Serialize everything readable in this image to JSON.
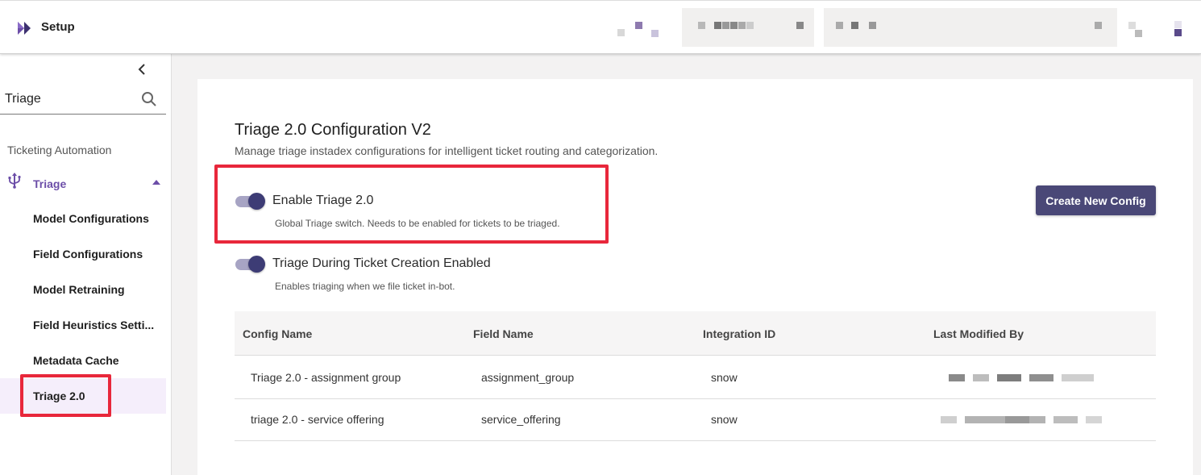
{
  "header": {
    "app_title": "Setup",
    "logo_icon": "double-chevron-logo-icon",
    "accent_color": "#6c4ea8"
  },
  "sidebar": {
    "collapse_icon": "chevron-left-icon",
    "search": {
      "value": "Triage",
      "icon": "search-icon"
    },
    "section_label": "Ticketing Automation",
    "parent": {
      "label": "Triage",
      "icon": "usb-icon",
      "expanded": true
    },
    "items": [
      {
        "label": "Model Configurations"
      },
      {
        "label": "Field Configurations"
      },
      {
        "label": "Model Retraining"
      },
      {
        "label": "Field Heuristics Setti..."
      },
      {
        "label": "Metadata Cache"
      },
      {
        "label": "Triage 2.0",
        "active": true
      }
    ]
  },
  "main": {
    "title": "Triage 2.0 Configuration V2",
    "subtitle": "Manage triage instadex configurations for intelligent ticket routing and categorization.",
    "toggles": [
      {
        "title": "Enable Triage 2.0",
        "description": "Global Triage switch. Needs to be enabled for tickets to be triaged.",
        "enabled": true
      },
      {
        "title": "Triage During Ticket Creation Enabled",
        "description": "Enables triaging when we file ticket in-bot.",
        "enabled": true
      }
    ],
    "create_button": "Create New Config",
    "button_color": "#4a4877",
    "table": {
      "columns": [
        "Config Name",
        "Field Name",
        "Integration ID",
        "Last Modified By"
      ],
      "rows": [
        {
          "config_name": "Triage 2.0 - assignment group",
          "field_name": "assignment_group",
          "integration_id": "snow"
        },
        {
          "config_name": "triage 2.0 - service offering",
          "field_name": "service_offering",
          "integration_id": "snow"
        }
      ]
    }
  },
  "highlight_color": "#e8273b"
}
